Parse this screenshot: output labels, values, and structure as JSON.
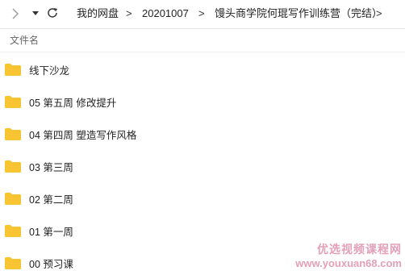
{
  "toolbar": {
    "back_icon": "chevron-left-icon",
    "dropdown_icon": "caret-down-icon",
    "refresh_icon": "refresh-icon"
  },
  "breadcrumb": {
    "items": [
      "我的网盘",
      "20201007",
      "馒头商学院何琨写作训练营（完结）"
    ],
    "separator": ">"
  },
  "list": {
    "column_header": "文件名",
    "folder_color": "#f7c531",
    "items": [
      {
        "name": "线下沙龙"
      },
      {
        "name": "05 第五周 修改提升"
      },
      {
        "name": "04 第四周 塑造写作风格"
      },
      {
        "name": "03 第三周"
      },
      {
        "name": "02 第二周"
      },
      {
        "name": "01 第一周"
      },
      {
        "name": "00 预习课"
      }
    ]
  },
  "watermark": {
    "title": "优选视频课程网",
    "url": "www.youxuan68.com"
  }
}
